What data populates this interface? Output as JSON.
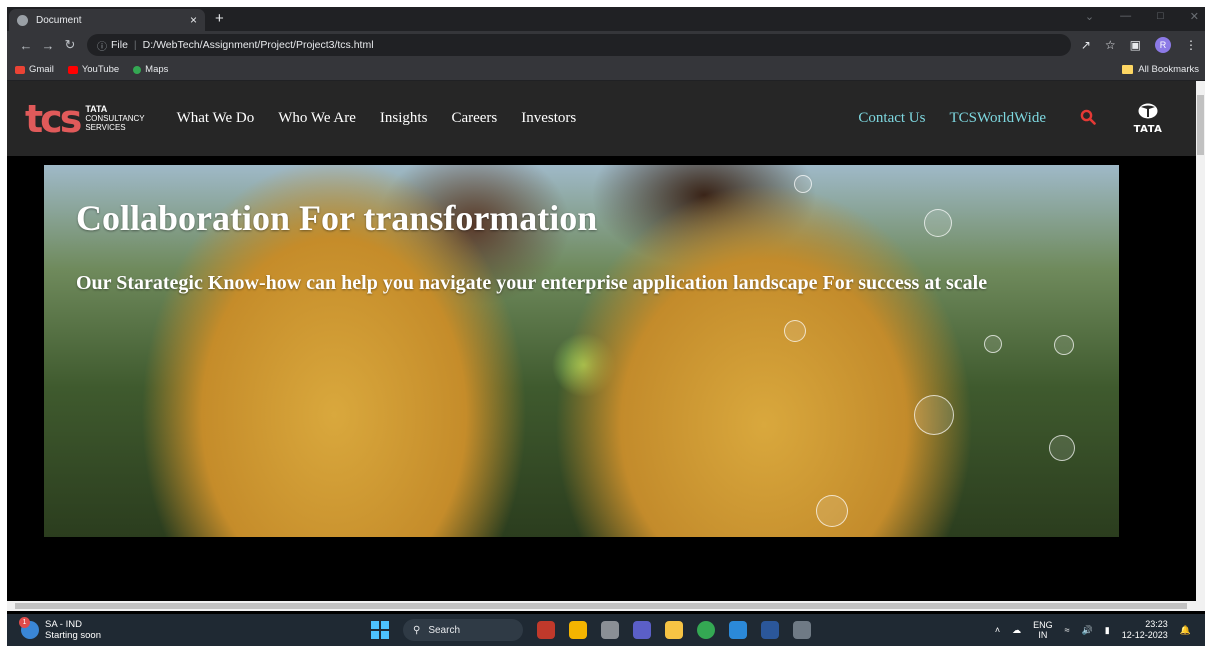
{
  "browser": {
    "tab_title": "Document",
    "new_tab": "+",
    "close_tab": "×",
    "url_scheme": "File",
    "url": "D:/WebTech/Assignment/Project/Project3/tcs.html",
    "profile_initial": "R",
    "bookmarks": [
      {
        "label": "Gmail",
        "color": "#ea4335"
      },
      {
        "label": "YouTube",
        "color": "#ff0000"
      },
      {
        "label": "Maps",
        "color": "#34a853"
      }
    ],
    "all_bookmarks": "All Bookmarks"
  },
  "site": {
    "logo_mark": "tcs",
    "logo_line1": "TATA",
    "logo_line2": "CONSULTANCY",
    "logo_line3": "SERVICES",
    "nav": [
      "What We Do",
      "Who We Are",
      "Insights",
      "Careers",
      "Investors"
    ],
    "right_nav": [
      "Contact Us",
      "TCSWorldWide"
    ],
    "brand": "TATA",
    "colors": {
      "header_bg": "#262626",
      "accent_link": "#7ed8e0",
      "logo_red": "#e05a5a",
      "search_red": "#e53935"
    }
  },
  "hero": {
    "title": "Collaboration For transformation",
    "subtitle": "Our Starategic Know-how can help you navigate your enterprise application landscape For success at scale"
  },
  "taskbar": {
    "weather_title": "SA - IND",
    "weather_sub": "Starting soon",
    "weather_badge": "1",
    "search_label": "Search",
    "lang_top": "ENG",
    "lang_bottom": "IN",
    "time": "23:23",
    "date": "12-12-2023"
  }
}
